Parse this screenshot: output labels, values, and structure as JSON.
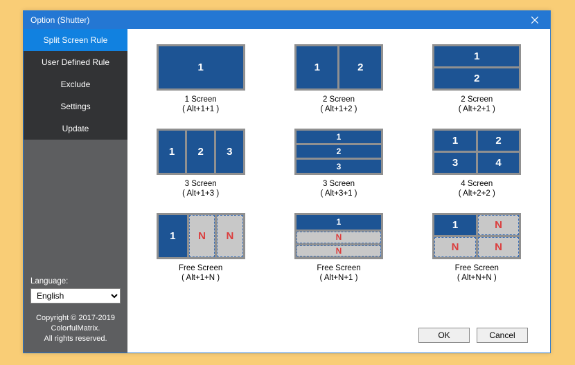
{
  "window": {
    "title": "Option (Shutter)"
  },
  "sidebar": {
    "items": [
      {
        "label": "Split Screen Rule",
        "active": true
      },
      {
        "label": "User Defined Rule",
        "active": false
      },
      {
        "label": "Exclude",
        "active": false
      },
      {
        "label": "Settings",
        "active": false
      },
      {
        "label": "Update",
        "active": false
      }
    ],
    "language_label": "Language:",
    "language_value": "English",
    "copyright_l1": "Copyright © 2017-2019",
    "copyright_l2": "ColorfulMatrix.",
    "copyright_l3": "All rights reserved."
  },
  "rules": [
    {
      "title": "1 Screen",
      "hotkey": "( Alt+1+1 )",
      "layout": "g-1",
      "panes": [
        {
          "t": "1"
        }
      ]
    },
    {
      "title": "2 Screen",
      "hotkey": "( Alt+1+2 )",
      "layout": "g-1x2",
      "panes": [
        {
          "t": "1"
        },
        {
          "t": "2"
        }
      ]
    },
    {
      "title": "2 Screen",
      "hotkey": "( Alt+2+1 )",
      "layout": "g-2x1",
      "panes": [
        {
          "t": "1"
        },
        {
          "t": "2"
        }
      ]
    },
    {
      "title": "3 Screen",
      "hotkey": "( Alt+1+3 )",
      "layout": "g-1x3",
      "panes": [
        {
          "t": "1"
        },
        {
          "t": "2"
        },
        {
          "t": "3"
        }
      ]
    },
    {
      "title": "3 Screen",
      "hotkey": "( Alt+3+1 )",
      "layout": "g-3x1",
      "panes": [
        {
          "t": "1"
        },
        {
          "t": "2"
        },
        {
          "t": "3"
        }
      ]
    },
    {
      "title": "4 Screen",
      "hotkey": "( Alt+2+2 )",
      "layout": "g-2x2",
      "panes": [
        {
          "t": "1"
        },
        {
          "t": "2"
        },
        {
          "t": "3"
        },
        {
          "t": "4"
        }
      ]
    },
    {
      "title": "Free Screen",
      "hotkey": "( Alt+1+N )",
      "layout": "g-alt1n",
      "panes": [
        {
          "t": "1"
        },
        {
          "t": "N",
          "free": true
        },
        {
          "t": "N",
          "free": true
        }
      ]
    },
    {
      "title": "Free Screen",
      "hotkey": "( Alt+N+1 )",
      "layout": "g-altn1",
      "panes": [
        {
          "t": "1"
        },
        {
          "t": "N",
          "free": true
        },
        {
          "t": "N",
          "free": true
        }
      ]
    },
    {
      "title": "Free Screen",
      "hotkey": "( Alt+N+N )",
      "layout": "g-altnn",
      "panes": [
        {
          "t": "1"
        },
        {
          "t": "N",
          "free": true
        },
        {
          "t": "N",
          "free": true
        },
        {
          "t": "N",
          "free": true
        }
      ]
    }
  ],
  "buttons": {
    "ok": "OK",
    "cancel": "Cancel"
  }
}
